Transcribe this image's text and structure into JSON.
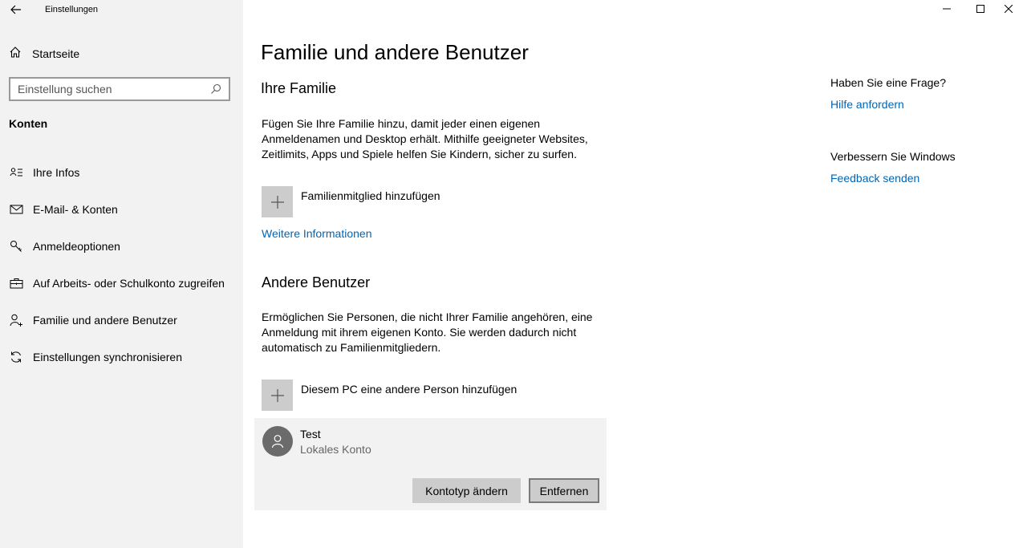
{
  "app": {
    "title": "Einstellungen",
    "back_icon": "back-arrow-icon",
    "controls": {
      "minimize_icon": "minimize-icon",
      "maximize_icon": "maximize-icon",
      "close_icon": "close-icon"
    }
  },
  "sidebar": {
    "home_label": "Startseite",
    "search_placeholder": "Einstellung suchen",
    "section_label": "Konten",
    "items": [
      {
        "label": "Ihre Infos",
        "icon": "contact-card-icon"
      },
      {
        "label": "E-Mail- & Konten",
        "icon": "mail-icon"
      },
      {
        "label": "Anmeldeoptionen",
        "icon": "key-icon"
      },
      {
        "label": "Auf Arbeits- oder Schulkonto zugreifen",
        "icon": "briefcase-icon"
      },
      {
        "label": "Familie und andere Benutzer",
        "icon": "person-add-icon"
      },
      {
        "label": "Einstellungen synchronisieren",
        "icon": "sync-icon"
      }
    ]
  },
  "main": {
    "title": "Familie und andere Benutzer",
    "family": {
      "heading": "Ihre Familie",
      "description": "Fügen Sie Ihre Familie hinzu, damit jeder einen eigenen Anmeldenamen und Desktop erhält. Mithilfe geeigneter Websites, Zeitlimits, Apps und Spiele helfen Sie Kindern, sicher zu surfen.",
      "add_label": "Familienmitglied hinzufügen",
      "more_info_link": "Weitere Informationen"
    },
    "others": {
      "heading": "Andere Benutzer",
      "description": "Ermöglichen Sie Personen, die nicht Ihrer Familie angehören, eine Anmeldung mit ihrem eigenen Konto. Sie werden dadurch nicht automatisch zu Familienmitgliedern.",
      "add_label": "Diesem PC eine andere Person hinzufügen",
      "user": {
        "name": "Test",
        "account_type": "Lokales Konto",
        "change_type_button": "Kontotyp ändern",
        "remove_button": "Entfernen"
      }
    }
  },
  "aside": {
    "question": "Haben Sie eine Frage?",
    "help_link": "Hilfe anfordern",
    "improve": "Verbessern Sie Windows",
    "feedback_link": "Feedback senden"
  },
  "colors": {
    "accent": "#0066b4",
    "sidebar_bg": "#f2f2f2",
    "button_bg": "#cccccc"
  }
}
